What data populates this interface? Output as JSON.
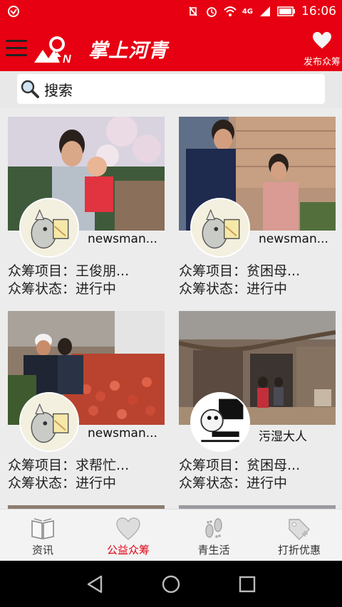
{
  "status_bar": {
    "time": "16:06",
    "signal_label": "4G",
    "icons": [
      "notification-icon",
      "vibrate-icon",
      "alarm-icon",
      "wifi-icon",
      "signal-icon",
      "battery-icon"
    ]
  },
  "header": {
    "logo_text": "掌上河青",
    "publish_label": "发布众筹"
  },
  "search": {
    "placeholder": "搜索"
  },
  "cards": [
    {
      "username": "newsman...",
      "project_label": "众筹项目：",
      "project": "王俊朋...",
      "status_label": "众筹状态：",
      "status": "进行中"
    },
    {
      "username": "newsman...",
      "project_label": "众筹项目：",
      "project": "贫困母...",
      "status_label": "众筹状态：",
      "status": "进行中"
    },
    {
      "username": "newsman...",
      "project_label": "众筹项目：",
      "project": "求帮忙...",
      "status_label": "众筹状态：",
      "status": "进行中"
    },
    {
      "username": "污湿大人",
      "project_label": "众筹项目：",
      "project": "贫困母...",
      "status_label": "众筹状态：",
      "status": "进行中"
    }
  ],
  "tabs": [
    {
      "label": "资讯",
      "icon": "book-icon",
      "active": false
    },
    {
      "label": "公益众筹",
      "icon": "heart-icon",
      "active": true
    },
    {
      "label": "青生活",
      "icon": "footprints-icon",
      "active": false
    },
    {
      "label": "打折优惠",
      "icon": "tag-icon",
      "active": false
    }
  ],
  "colors": {
    "brand_red": "#e60012",
    "active_tab": "#e60012"
  }
}
